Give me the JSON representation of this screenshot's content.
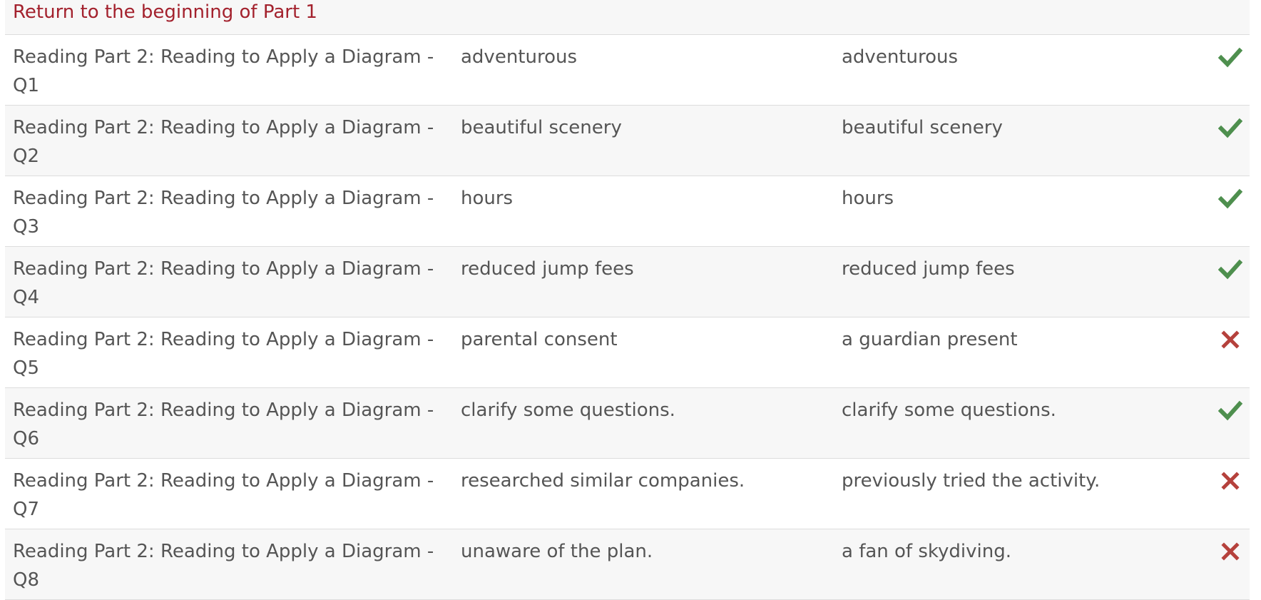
{
  "return_link": {
    "label": "Return to the beginning of Part 1"
  },
  "colors": {
    "link": "#a3212d",
    "correct": "#4e8f4e",
    "incorrect": "#b5413c"
  },
  "rows": [
    {
      "question_line1": "Reading Part 2: Reading to Apply a Diagram -",
      "question_line2": "Q1",
      "your_answer": "adventurous",
      "correct_answer": "adventurous",
      "status": "correct"
    },
    {
      "question_line1": "Reading Part 2: Reading to Apply a Diagram -",
      "question_line2": "Q2",
      "your_answer": "beautiful scenery",
      "correct_answer": "beautiful scenery",
      "status": "correct"
    },
    {
      "question_line1": "Reading Part 2: Reading to Apply a Diagram -",
      "question_line2": "Q3",
      "your_answer": "hours",
      "correct_answer": "hours",
      "status": "correct"
    },
    {
      "question_line1": "Reading Part 2: Reading to Apply a Diagram -",
      "question_line2": "Q4",
      "your_answer": "reduced jump fees",
      "correct_answer": "reduced jump fees",
      "status": "correct"
    },
    {
      "question_line1": "Reading Part 2: Reading to Apply a Diagram -",
      "question_line2": "Q5",
      "your_answer": "parental consent",
      "correct_answer": "a guardian present",
      "status": "incorrect"
    },
    {
      "question_line1": "Reading Part 2: Reading to Apply a Diagram -",
      "question_line2": "Q6",
      "your_answer": "clarify some questions.",
      "correct_answer": "clarify some questions.",
      "status": "correct"
    },
    {
      "question_line1": "Reading Part 2: Reading to Apply a Diagram -",
      "question_line2": "Q7",
      "your_answer": "researched similar companies.",
      "correct_answer": "previously tried the activity.",
      "status": "incorrect"
    },
    {
      "question_line1": "Reading Part 2: Reading to Apply a Diagram -",
      "question_line2": "Q8",
      "your_answer": "unaware of the plan.",
      "correct_answer": "a fan of skydiving.",
      "status": "incorrect"
    }
  ]
}
